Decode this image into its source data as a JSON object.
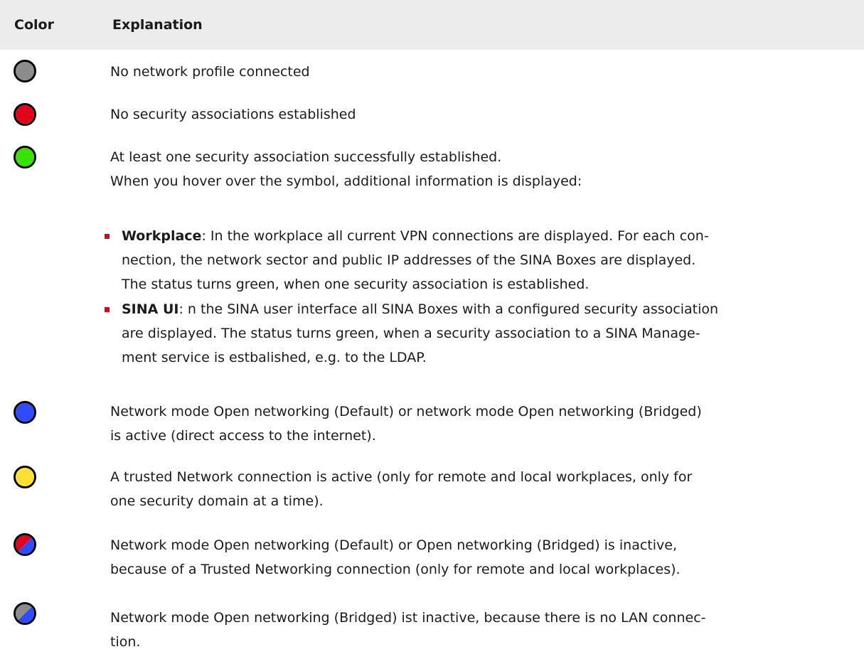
{
  "table": {
    "header": {
      "color": "Color",
      "explanation": "Explanation"
    },
    "rows": [
      {
        "swatch": {
          "name": "gray-status-icon",
          "color": "#8c8c8c"
        },
        "lines": [
          "No network profile connected"
        ]
      },
      {
        "swatch": {
          "name": "red-status-icon",
          "color": "#e2001a"
        },
        "lines": [
          "No security associations established"
        ]
      },
      {
        "swatch": {
          "name": "green-status-icon",
          "color": "#39e100"
        },
        "lines": [
          "At least one security association successfully established.",
          "When you hover over the symbol, additional information is displayed:"
        ],
        "bullets": [
          {
            "term": "Workplace",
            "lines": [
              ": In the workplace all current VPN connections are displayed. For each con-",
              "nection, the network sector and public IP addresses of the SINA Boxes are displayed.",
              "The status turns green, when one security association is established."
            ]
          },
          {
            "term": "SINA UI",
            "lines": [
              ": n the SINA user interface all SINA Boxes with a configured security association",
              "are displayed. The status turns green, when a security association to a SINA Manage-",
              "ment service is estbalished, e.g. to the LDAP."
            ]
          }
        ]
      },
      {
        "swatch": {
          "name": "blue-status-icon",
          "color": "#2f4bff"
        },
        "lines": [
          "Network mode Open networking (Default) or network mode Open networking (Bridged)",
          "is active (direct access to the internet)."
        ]
      },
      {
        "swatch": {
          "name": "yellow-status-icon",
          "color": "#ffe033"
        },
        "lines": [
          "A trusted Network connection is active (only for remote and local workplaces, only for",
          "one security domain at a time)."
        ]
      },
      {
        "swatch": {
          "name": "red-blue-status-icon",
          "color": "#e2001a",
          "color2": "#2f4bff"
        },
        "lines": [
          "Network mode Open networking (Default) or Open networking (Bridged) is inactive,",
          "because of a Trusted Networking connection (only for remote and local workplaces)."
        ]
      },
      {
        "swatch": {
          "name": "gray-blue-status-icon",
          "color": "#8c8c8c",
          "color2": "#2f4bff"
        },
        "lines": [
          "Network mode Open networking (Bridged) ist inactive, because there is no LAN connec-",
          "tion."
        ]
      }
    ]
  }
}
